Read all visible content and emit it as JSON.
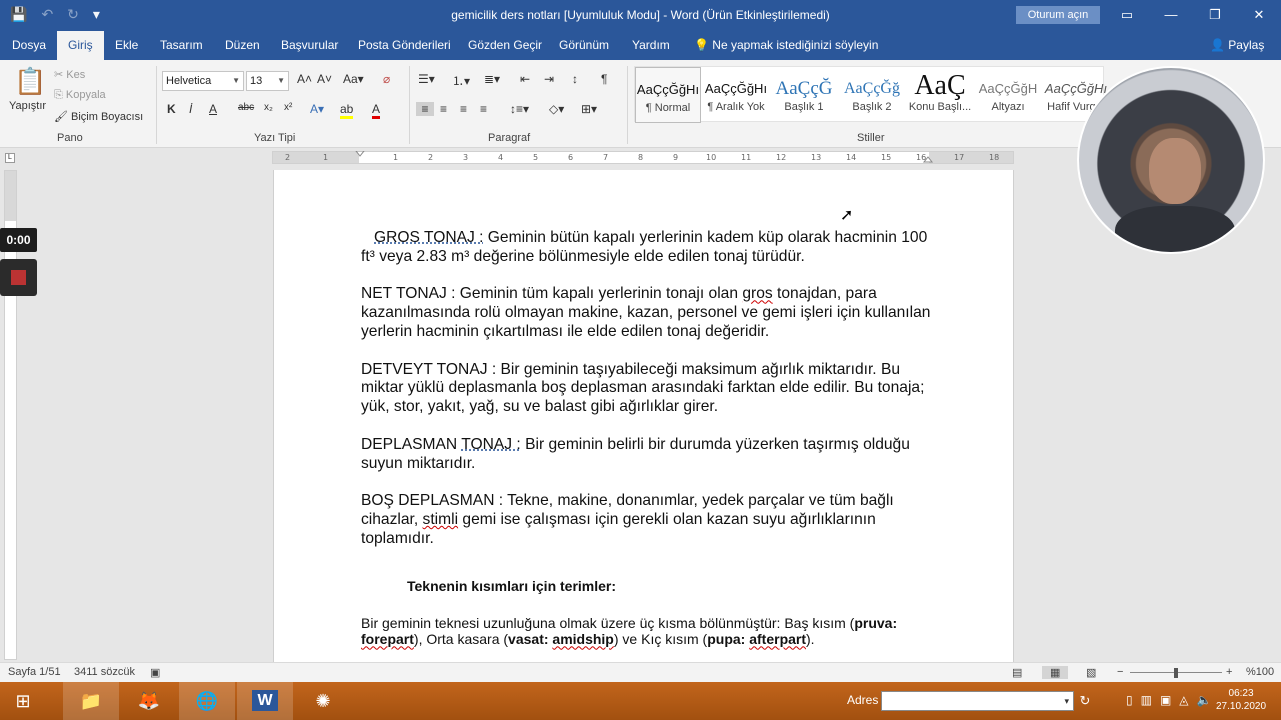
{
  "window": {
    "title": "gemicilik ders notları [Uyumluluk Modu] - Word (Ürün Etkinleştirilemedi)",
    "signin": "Oturum açın"
  },
  "tabs": [
    "Dosya",
    "Giriş",
    "Ekle",
    "Tasarım",
    "Düzen",
    "Başvurular",
    "Posta Gönderileri",
    "Gözden Geçir",
    "Görünüm",
    "Yardım"
  ],
  "tell_me": "Ne yapmak istediğinizi söyleyin",
  "share": "Paylaş",
  "ribbon": {
    "clipboard": {
      "paste": "Yapıştır",
      "cut": "Kes",
      "copy": "Kopyala",
      "painter": "Biçim Boyacısı",
      "label": "Pano"
    },
    "font": {
      "name": "Helvetica",
      "size": "13",
      "label": "Yazı Tipi",
      "bold": "K",
      "italic": "İ",
      "underline": "A"
    },
    "paragraph": {
      "label": "Paragraf"
    },
    "styles": {
      "label": "Stiller",
      "items": [
        {
          "preview": "AaÇçĞğHı",
          "name": "¶ Normal"
        },
        {
          "preview": "AaÇçĞğHı",
          "name": "¶ Aralık Yok"
        },
        {
          "preview": "AaÇçĞ",
          "name": "Başlık 1"
        },
        {
          "preview": "AaÇçĞğ",
          "name": "Başlık 2"
        },
        {
          "preview": "AaÇ",
          "name": "Konu Başlı..."
        },
        {
          "preview": "AaÇçĞğH",
          "name": "Altyazı"
        },
        {
          "preview": "AaÇçĞğHı",
          "name": "Hafif Vurg..."
        }
      ]
    }
  },
  "recorder": {
    "time": "0:00"
  },
  "document": {
    "p1_term": "GROS TONAJ :",
    "p1_rest": " Geminin bütün kapalı yerlerinin kadem küp olarak hacminin 100 ft³ veya 2.83 m³ değerine bölünmesiyle elde edilen tonaj türüdür.",
    "p2_a": "NET TONAJ : Geminin tüm kapalı yerlerinin tonajı olan ",
    "p2_gros": "gros",
    "p2_b": " tonajdan, para kazanılmasında rolü olmayan makine, kazan, personel ve gemi işleri için kullanılan yerlerin hacminin çıkartılması ile elde edilen tonaj değeridir.",
    "p3": "DETVEYT TONAJ : Bir geminin taşıyabileceği maksimum ağırlık miktarıdır. Bu miktar yüklü deplasmanla boş deplasman arasındaki farktan elde edilir. Bu tonaja; yük, stor, yakıt, yağ, su ve balast gibi ağırlıklar girer.",
    "p4_a": "DEPLASMAN ",
    "p4_term": "TONAJ :",
    "p4_b": " Bir geminin belirli bir durumda yüzerken taşırmış olduğu suyun miktarıdır.",
    "p5_a": "BOŞ DEPLASMAN : Tekne, makine, donanımlar, yedek parçalar ve tüm bağlı cihazlar, ",
    "p5_stimli": "stimli",
    "p5_b": " gemi ise çalışması için gerekli olan kazan suyu ağırlıklarının toplamıdır.",
    "heading": "Teknenin kısımları için terimler:",
    "p6_a": "Bir geminin teknesi uzunluğuna olmak üzere üç kısma bölünmüştür: Baş kısım (",
    "p6_pruva": "pruva: ",
    "p6_forepart": "forepart",
    "p6_b": "), Orta kasara (",
    "p6_vasat": "vasat: ",
    "p6_amidship": "amidship",
    "p6_c": ") ve Kıç kısım (",
    "p6_pupa": "pupa: ",
    "p6_afterpart": "afterpart",
    "p6_d": ")."
  },
  "status": {
    "page": "Sayfa 1/51",
    "words": "3411 sözcük",
    "zoom": "%100"
  },
  "taskbar": {
    "address_label": "Adres",
    "time": "06:23",
    "date": "27.10.2020"
  },
  "colors": {
    "word_blue": "#2b579a",
    "taskbar": "#b25a15"
  }
}
